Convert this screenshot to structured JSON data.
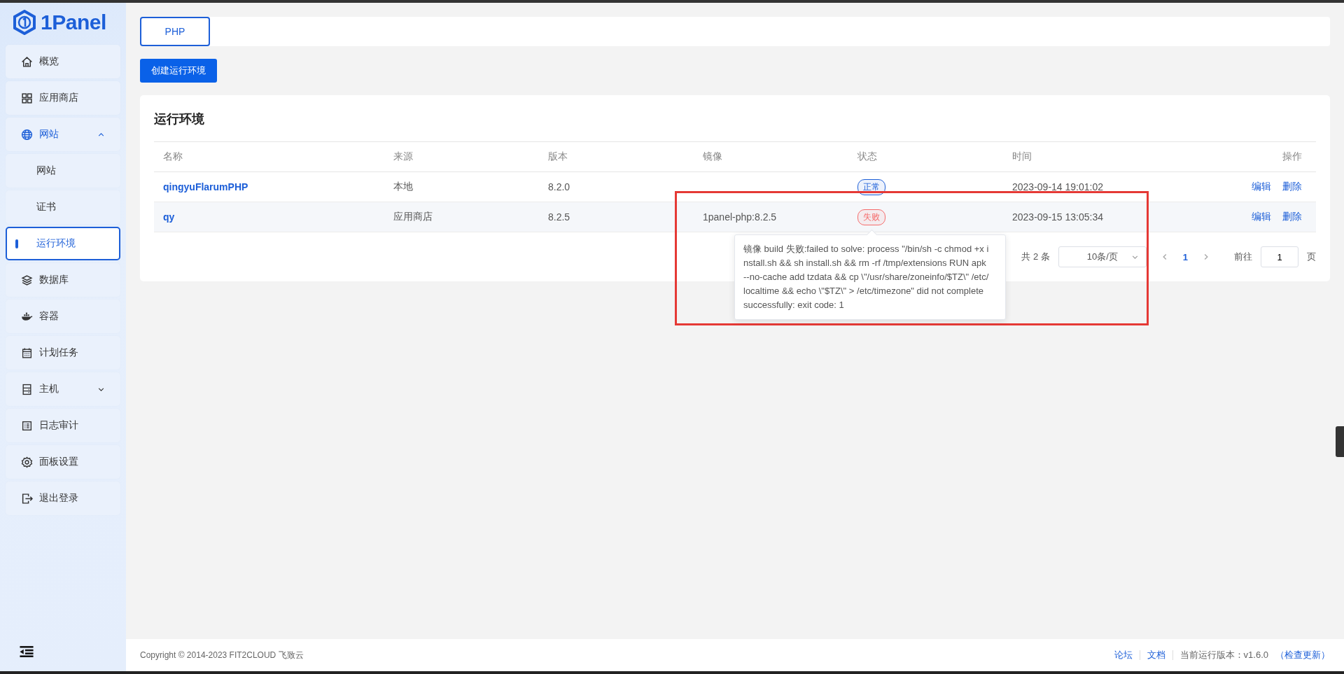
{
  "logo": {
    "text": "1Panel"
  },
  "sidebar": {
    "items": [
      {
        "label": "概览",
        "selected": false
      },
      {
        "label": "应用商店",
        "selected": false
      },
      {
        "label": "网站",
        "selected": false,
        "expanded": true,
        "children": [
          {
            "label": "网站",
            "selected": false
          },
          {
            "label": "证书",
            "selected": false
          },
          {
            "label": "运行环境",
            "selected": true
          }
        ]
      },
      {
        "label": "数据库",
        "selected": false
      },
      {
        "label": "容器",
        "selected": false
      },
      {
        "label": "计划任务",
        "selected": false
      },
      {
        "label": "主机",
        "selected": false,
        "expanded": false
      },
      {
        "label": "日志审计",
        "selected": false
      },
      {
        "label": "面板设置",
        "selected": false
      },
      {
        "label": "退出登录",
        "selected": false
      }
    ]
  },
  "tabs": [
    {
      "label": "PHP",
      "selected": true
    }
  ],
  "create_button": "创建运行环境",
  "card_title": "运行环境",
  "table": {
    "columns": [
      "名称",
      "来源",
      "版本",
      "镜像",
      "状态",
      "时间",
      "操作"
    ],
    "rows": [
      {
        "name": "qingyuFlarumPHP",
        "source": "本地",
        "version": "8.2.0",
        "image": "",
        "status": {
          "text": "正常",
          "color": "#1d5fd8"
        },
        "time": "2023-09-14 19:01:02",
        "actions": [
          "编辑",
          "删除"
        ]
      },
      {
        "name": "qy",
        "source": "应用商店",
        "version": "8.2.5",
        "image": "1panel-php:8.2.5",
        "status": {
          "text": "失败",
          "color": "#f56c6c"
        },
        "time": "2023-09-15 13:05:34",
        "actions": [
          "编辑",
          "删除"
        ]
      }
    ]
  },
  "pagination": {
    "total": "共 2 条",
    "page_size": "10条/页",
    "pages": [
      {
        "label": "1",
        "selected": true
      }
    ],
    "goto_label": "前往",
    "goto_value": "1",
    "page_suffix": "页"
  },
  "tooltip": "镜像 build 失败:failed to solve: process \"/bin/sh -c chmod +x install.sh && sh install.sh && rm -rf /tmp/extensions RUN apk --no-cache add tzdata && cp \\\"/usr/share/zoneinfo/$TZ\\\" /etc/localtime && echo \\\"$TZ\\\" > /etc/timezone\" did not complete successfully: exit code: 1",
  "footer": {
    "copyright": "Copyright © 2014-2023 FIT2CLOUD 飞致云",
    "links": [
      "论坛",
      "文档"
    ],
    "version_label": "当前运行版本：v1.6.0",
    "update_link": "（检查更新）"
  }
}
